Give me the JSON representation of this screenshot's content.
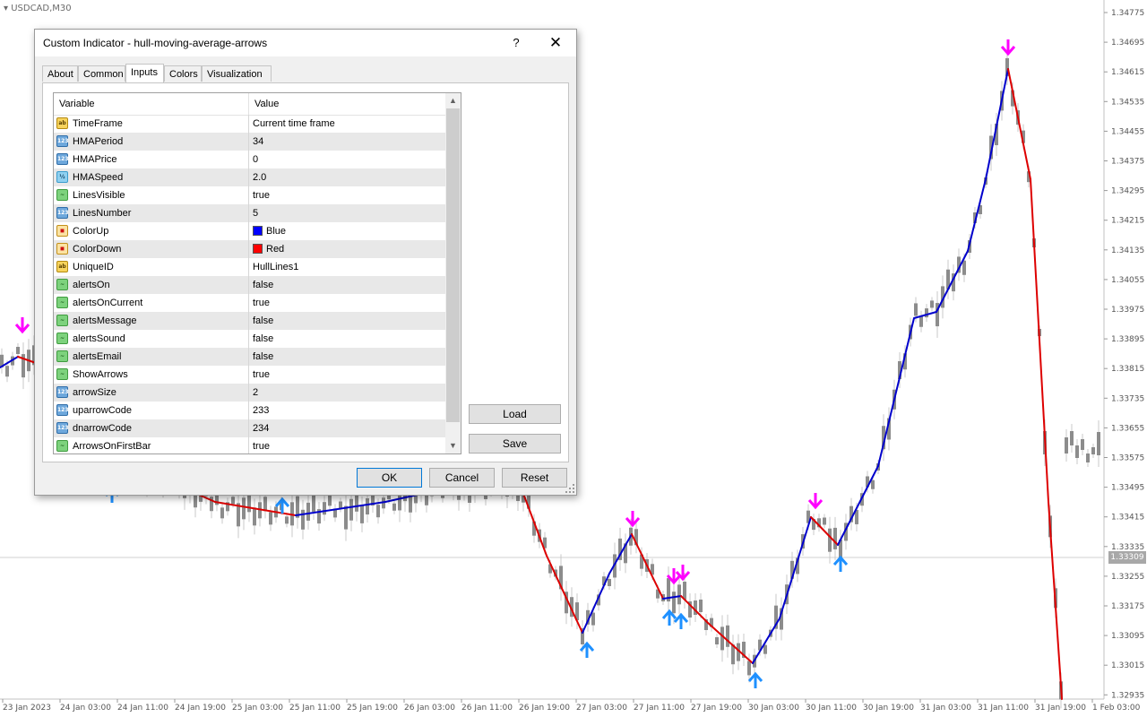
{
  "chart": {
    "symbol": "USDCAD,M30",
    "current_price": "1.33309",
    "price_axis": [
      "1.34775",
      "1.34695",
      "1.34615",
      "1.34535",
      "1.34455",
      "1.34375",
      "1.34295",
      "1.34215",
      "1.34135",
      "1.34055",
      "1.33975",
      "1.33895",
      "1.33815",
      "1.33735",
      "1.33655",
      "1.33575",
      "1.33495",
      "1.33415",
      "1.33335",
      "1.33255",
      "1.33175",
      "1.33095",
      "1.33015",
      "1.32935"
    ],
    "time_axis": [
      "23 Jan 2023",
      "24 Jan 03:00",
      "24 Jan 11:00",
      "24 Jan 19:00",
      "25 Jan 03:00",
      "25 Jan 11:00",
      "25 Jan 19:00",
      "26 Jan 03:00",
      "26 Jan 11:00",
      "26 Jan 19:00",
      "27 Jan 03:00",
      "27 Jan 11:00",
      "27 Jan 19:00",
      "30 Jan 03:00",
      "30 Jan 11:00",
      "30 Jan 19:00",
      "31 Jan 03:00",
      "31 Jan 11:00",
      "31 Jan 19:00",
      "1 Feb 03:00"
    ],
    "colors": {
      "up": "#0000cc",
      "down": "#dd0000",
      "arrow_up": "#1e90ff",
      "arrow_down": "#ff00ff",
      "candle": "#8c8c8c"
    }
  },
  "dialog": {
    "title": "Custom Indicator - hull-moving-average-arrows",
    "help_label": "?",
    "close_label": "✕",
    "tabs": [
      "About",
      "Common",
      "Inputs",
      "Colors",
      "Visualization"
    ],
    "active_tab": "Inputs",
    "table": {
      "col_variable": "Variable",
      "col_value": "Value",
      "rows": [
        {
          "type": "ab",
          "name": "TimeFrame",
          "value": "Current time frame"
        },
        {
          "type": "num",
          "name": "HMAPeriod",
          "value": "34"
        },
        {
          "type": "num",
          "name": "HMAPrice",
          "value": "0"
        },
        {
          "type": "frac",
          "name": "HMASpeed",
          "value": "2.0"
        },
        {
          "type": "bool",
          "name": "LinesVisible",
          "value": "true"
        },
        {
          "type": "num",
          "name": "LinesNumber",
          "value": "5"
        },
        {
          "type": "color",
          "name": "ColorUp",
          "value": "Blue",
          "swatch": "#0000ff"
        },
        {
          "type": "color",
          "name": "ColorDown",
          "value": "Red",
          "swatch": "#ff0000"
        },
        {
          "type": "ab",
          "name": "UniqueID",
          "value": "HullLines1"
        },
        {
          "type": "bool",
          "name": "alertsOn",
          "value": "false"
        },
        {
          "type": "bool",
          "name": "alertsOnCurrent",
          "value": "true"
        },
        {
          "type": "bool",
          "name": "alertsMessage",
          "value": "false"
        },
        {
          "type": "bool",
          "name": "alertsSound",
          "value": "false"
        },
        {
          "type": "bool",
          "name": "alertsEmail",
          "value": "false"
        },
        {
          "type": "bool",
          "name": "ShowArrows",
          "value": "true"
        },
        {
          "type": "num",
          "name": "arrowSize",
          "value": "2"
        },
        {
          "type": "num",
          "name": "uparrowCode",
          "value": "233"
        },
        {
          "type": "num",
          "name": "dnarrowCode",
          "value": "234"
        },
        {
          "type": "bool",
          "name": "ArrowsOnFirstBar",
          "value": "true"
        }
      ]
    },
    "buttons": {
      "load": "Load",
      "save": "Save",
      "ok": "OK",
      "cancel": "Cancel",
      "reset": "Reset"
    }
  }
}
